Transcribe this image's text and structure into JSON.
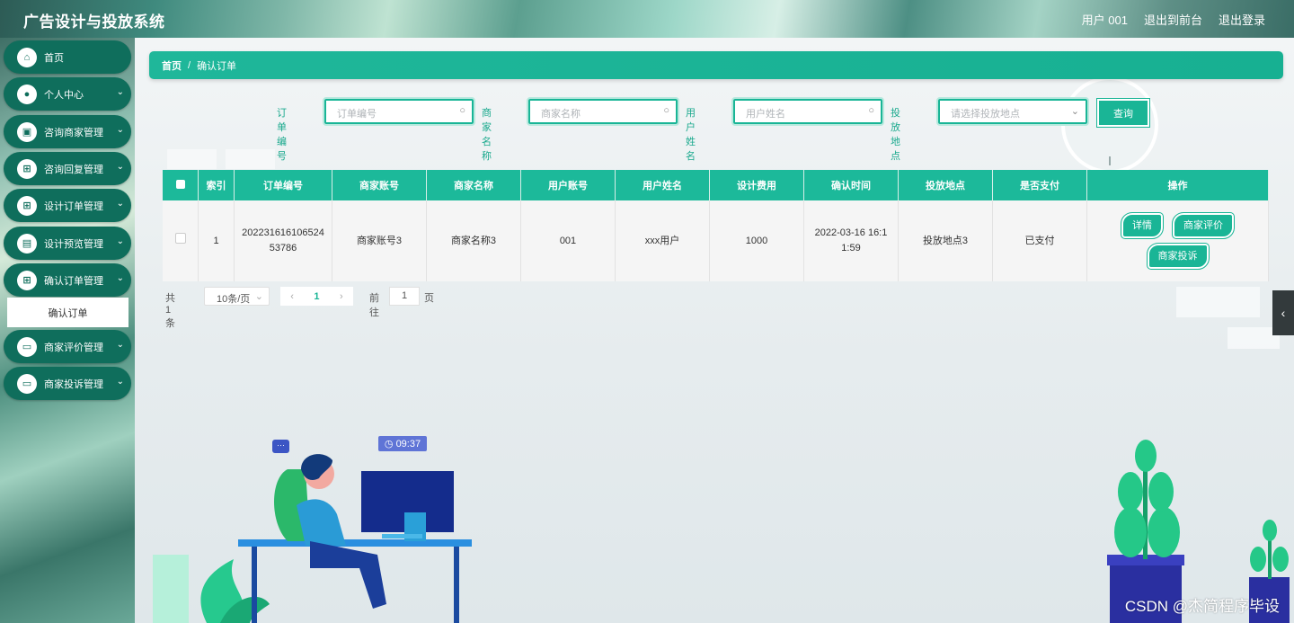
{
  "header": {
    "brand": "广告设计与投放系统",
    "user": "用户 001",
    "to_front": "退出到前台",
    "logout": "退出登录"
  },
  "sidebar": {
    "items": [
      {
        "label": "首页",
        "icon": "home-icon",
        "chevron": false
      },
      {
        "label": "个人中心",
        "icon": "user-icon",
        "chevron": true
      },
      {
        "label": "咨询商家管理",
        "icon": "briefcase-icon",
        "chevron": true
      },
      {
        "label": "咨询回复管理",
        "icon": "grid-icon",
        "chevron": true
      },
      {
        "label": "设计订单管理",
        "icon": "grid-icon",
        "chevron": true
      },
      {
        "label": "设计预览管理",
        "icon": "doc-icon",
        "chevron": true
      },
      {
        "label": "确认订单管理",
        "icon": "grid-icon",
        "chevron": true
      },
      {
        "label": "商家评价管理",
        "icon": "monitor-icon",
        "chevron": true
      },
      {
        "label": "商家投诉管理",
        "icon": "monitor-icon",
        "chevron": true
      }
    ],
    "submenu_active": "确认订单"
  },
  "breadcrumb": {
    "home": "首页",
    "sep": "/",
    "current": "确认订单"
  },
  "search": {
    "order_no_label": "订单编号",
    "order_no_placeholder": "订单编号",
    "merchant_label": "商家名称",
    "merchant_placeholder": "商家名称",
    "username_label": "用户姓名",
    "username_placeholder": "用户姓名",
    "location_label": "投放地点",
    "location_placeholder": "请选择投放地点",
    "query_button": "查询"
  },
  "table": {
    "columns": [
      "索引",
      "订单编号",
      "商家账号",
      "商家名称",
      "用户账号",
      "用户姓名",
      "设计费用",
      "确认时间",
      "投放地点",
      "是否支付",
      "操作"
    ],
    "rows": [
      {
        "index": "1",
        "order_no": "20223161610652453786",
        "merchant_account": "商家账号3",
        "merchant_name": "商家名称3",
        "user_account": "001",
        "user_name": "xxx用户",
        "fee": "1000",
        "confirm_time": "2022-03-16 16:11:59",
        "location": "投放地点3",
        "paid": "已支付",
        "actions": {
          "detail": "详情",
          "review": "商家评价",
          "complaint": "商家投诉"
        }
      }
    ]
  },
  "pagination": {
    "total": "共 1 条",
    "page_size": "10条/页",
    "current_page": "1",
    "goto_label": "前往",
    "goto_value": "1",
    "page_suffix": "页"
  },
  "decor": {
    "clock": "09:37",
    "chat": "···"
  },
  "watermark": "CSDN @杰简程序毕设",
  "colors": {
    "accent": "#1ab596",
    "sidebar_item": "#0f6e5c"
  }
}
